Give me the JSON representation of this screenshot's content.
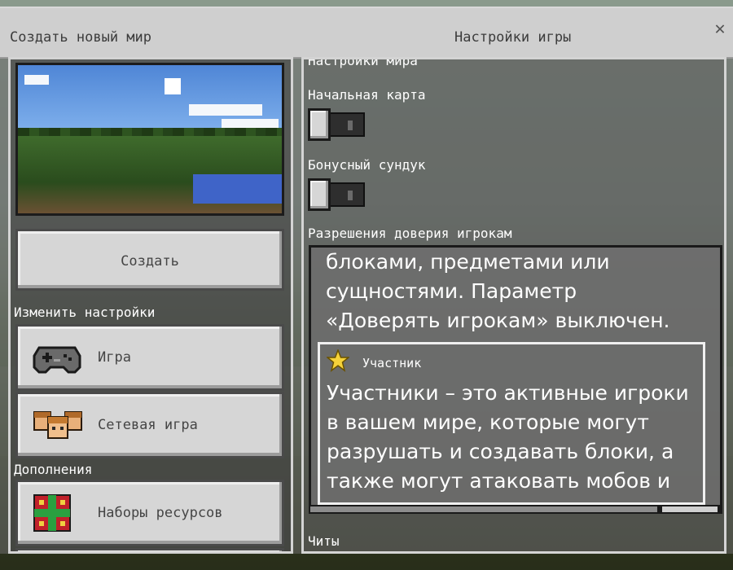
{
  "window": {
    "title_left": "Создать новый мир",
    "title_right": "Настройки игры",
    "close_icon": "close-icon"
  },
  "left": {
    "create_label": "Создать",
    "change_settings_label": "Изменить настройки",
    "addons_label": "Дополнения",
    "items": [
      {
        "label": "Игра",
        "icon": "gamepad-icon"
      },
      {
        "label": "Сетевая игра",
        "icon": "players-icon"
      },
      {
        "label": "Наборы ресурсов",
        "icon": "resource-pack-icon"
      }
    ]
  },
  "right": {
    "section_top": "Настройки мира",
    "starting_map_label": "Начальная карта",
    "starting_map_on": false,
    "bonus_chest_label": "Бонусный сундук",
    "bonus_chest_on": false,
    "permissions_label": "Разрешения доверия игрокам",
    "tooltip_lines": [
      "блоками, предметами или",
      "сущностями. Параметр",
      "«Доверять игрокам» выключен."
    ],
    "member": {
      "icon": "star-icon",
      "title": "Участник",
      "lines": [
        "Участники – это активные игроки",
        "в вашем мире, которые могут",
        "разрушать и создавать блоки, а",
        "также могут атаковать мобов и"
      ]
    },
    "cheats_label": "Читы"
  }
}
